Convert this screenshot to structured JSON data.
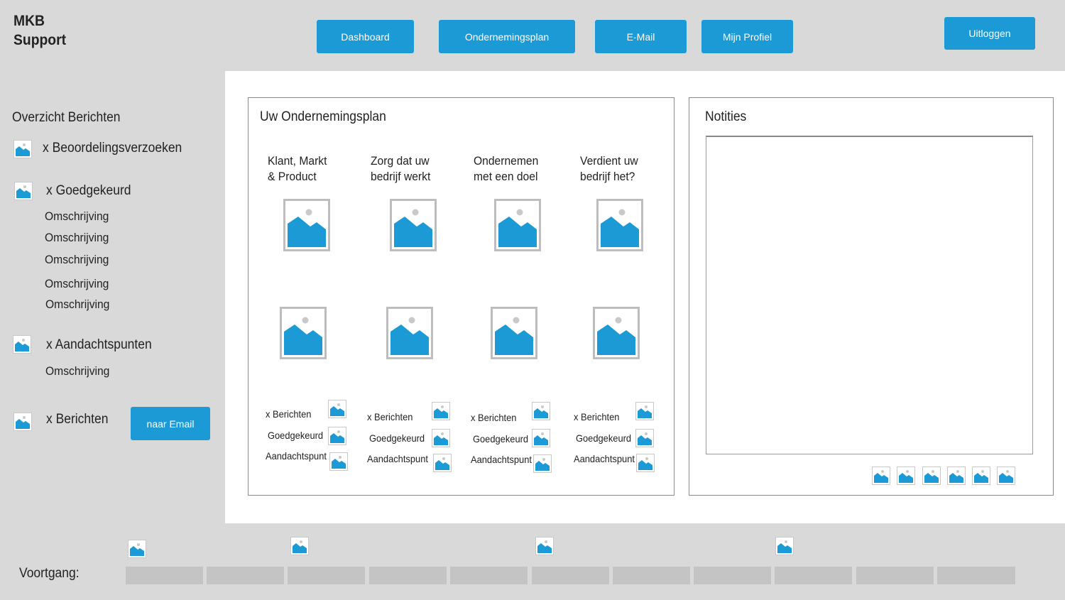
{
  "header": {
    "brand_line1": "MKB",
    "brand_line2": "Support",
    "nav": [
      "Dashboard",
      "Ondernemingsplan",
      "E-Mail",
      "Mijn Profiel"
    ],
    "logout": "Uitloggen"
  },
  "sidebar": {
    "title": "Overzicht Berichten",
    "beoordelingen": "x Beoordelingsverzoeken",
    "goedgekeurd": "x Goedgekeurd",
    "goedgekeurd_items": [
      "Omschrijving",
      "Omschrijving",
      "Omschrijving",
      "Omschrijving",
      "Omschrijving"
    ],
    "aandachtspunten": "x Aandachtspunten",
    "aandachtspunten_items": [
      "Omschrijving"
    ],
    "berichten": "x Berichten",
    "naar_email": "naar Email"
  },
  "plan": {
    "title": "Uw Ondernemingsplan",
    "categories": [
      {
        "title": "Klant, Markt\n& Product",
        "stats": [
          "x Berichten",
          "Goedgekeurd",
          "Aandachtspunt"
        ]
      },
      {
        "title": "Zorg dat uw\nbedrijf werkt",
        "stats": [
          "x Berichten",
          "Goedgekeurd",
          "Aandachtspunt"
        ]
      },
      {
        "title": "Ondernemen\nmet een doel",
        "stats": [
          "x Berichten",
          "Goedgekeurd",
          "Aandachtspunt"
        ]
      },
      {
        "title": "Verdient uw\nbedrijf het?",
        "stats": [
          "x Berichten",
          "Goedgekeurd",
          "Aandachtspunt"
        ]
      }
    ]
  },
  "notes": {
    "title": "Notities",
    "value": ""
  },
  "progress": {
    "label": "Voortgang:",
    "segments": 11
  },
  "colors": {
    "accent": "#1b9ad6",
    "background": "#d9d9d9",
    "panel": "#ffffff",
    "progress": "#c4c4c4"
  },
  "icons": {
    "placeholder": "image-placeholder-icon"
  }
}
